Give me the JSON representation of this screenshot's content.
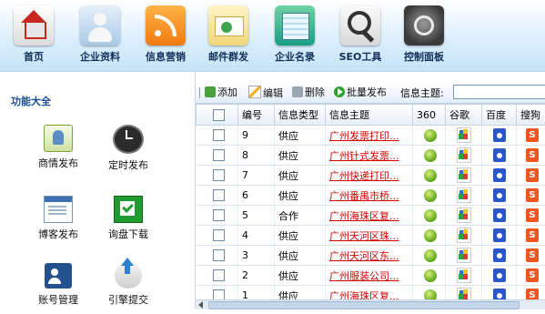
{
  "nav": [
    {
      "label": "首页",
      "icon": "home-icon"
    },
    {
      "label": "企业资料",
      "icon": "user-profile-icon"
    },
    {
      "label": "信息营销",
      "icon": "rss-icon"
    },
    {
      "label": "邮件群发",
      "icon": "mail-icon"
    },
    {
      "label": "企业名录",
      "icon": "directory-icon"
    },
    {
      "label": "SEO工具",
      "icon": "magnifier-icon"
    },
    {
      "label": "控制面板",
      "icon": "control-panel-icon"
    }
  ],
  "sidebar": {
    "title": "功能大全",
    "items": [
      {
        "label": "商情发布",
        "icon": "business-post-icon"
      },
      {
        "label": "定时发布",
        "icon": "clock-icon"
      },
      {
        "label": "博客发布",
        "icon": "blog-icon"
      },
      {
        "label": "询盘下载",
        "icon": "download-icon"
      },
      {
        "label": "账号管理",
        "icon": "account-icon"
      },
      {
        "label": "引擎提交",
        "icon": "upload-icon"
      }
    ]
  },
  "toolbar": {
    "add": "添加",
    "edit": "编辑",
    "delete": "删除",
    "batch": "批量发布",
    "search_label": "信息主题:",
    "search_value": ""
  },
  "table": {
    "headers": [
      "",
      "编号",
      "信息类型",
      "信息主题",
      "360",
      "谷歌",
      "百度",
      "搜狗"
    ],
    "rows": [
      {
        "id": "9",
        "type": "供应",
        "title": "广州发票打印..."
      },
      {
        "id": "8",
        "type": "供应",
        "title": "广州针式发票..."
      },
      {
        "id": "7",
        "type": "供应",
        "title": "广州快递打印..."
      },
      {
        "id": "6",
        "type": "供应",
        "title": "广州番禺市桥..."
      },
      {
        "id": "5",
        "type": "合作",
        "title": "广州海珠区复..."
      },
      {
        "id": "4",
        "type": "供应",
        "title": "广州天河区珠..."
      },
      {
        "id": "3",
        "type": "供应",
        "title": "广州天河区东..."
      },
      {
        "id": "2",
        "type": "供应",
        "title": "广州服装公司..."
      },
      {
        "id": "1",
        "type": "供应",
        "title": "广州海珠区复..."
      }
    ],
    "engine_icons": [
      "360-icon",
      "google-icon",
      "baidu-icon",
      "sogou-icon"
    ],
    "sogou_glyph": "S"
  }
}
